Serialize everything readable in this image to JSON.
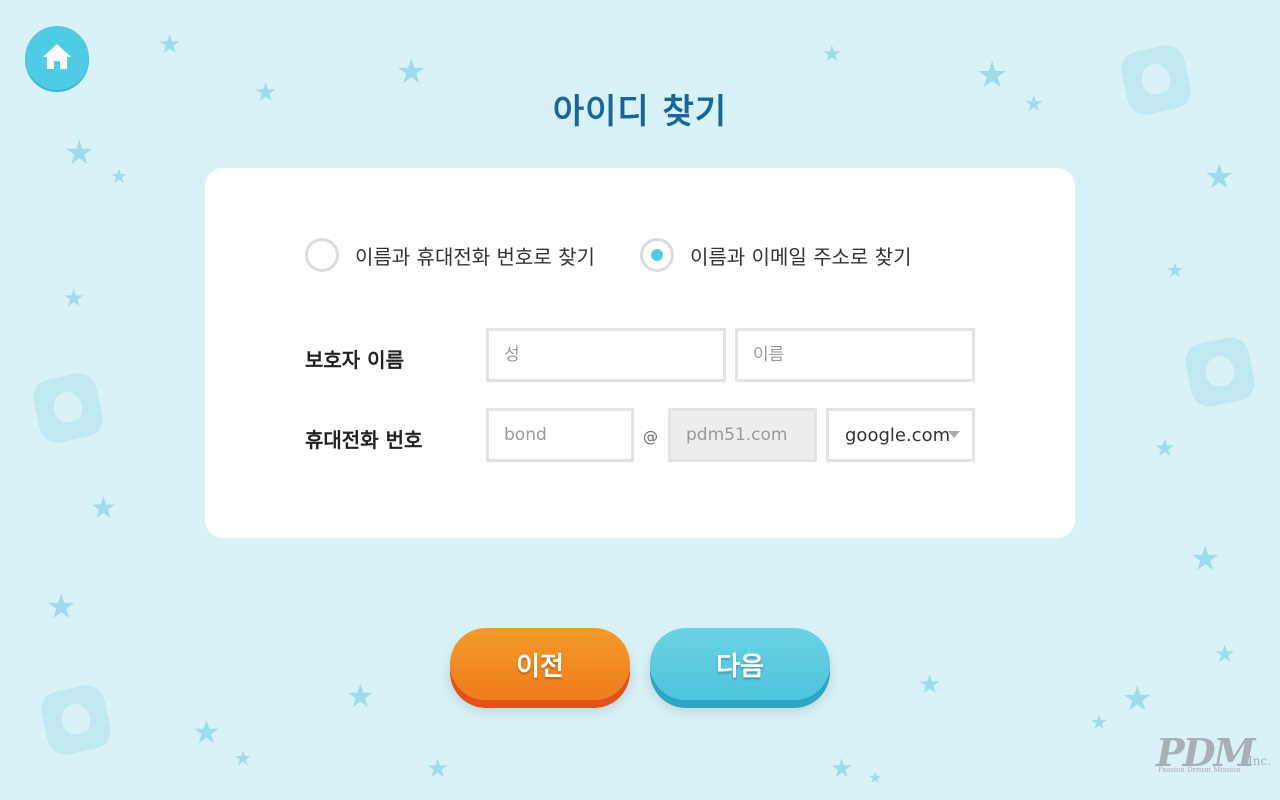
{
  "page": {
    "title": "아이디 찾기"
  },
  "search_options": [
    {
      "label": "이름과 휴대전화 번호로 찾기",
      "selected": false
    },
    {
      "label": "이름과 이메일 주소로 찾기",
      "selected": true
    }
  ],
  "form": {
    "guardian_name_label": "보호자 이름",
    "last_name_placeholder": "성",
    "first_name_placeholder": "이름",
    "phone_label": "휴대전화 번호",
    "email_id_placeholder": "bond",
    "at_symbol": "@",
    "email_domain_placeholder": "pdm51.com",
    "domain_select_value": "google.com"
  },
  "buttons": {
    "prev_label": "이전",
    "next_label": "다음"
  },
  "logo": {
    "mark": "PDM",
    "suffix": "Inc.",
    "tagline": "Passion Dream Mission"
  },
  "colors": {
    "background": "#d9f2f7",
    "title": "#17659a",
    "accent": "#4fcbe5",
    "prev_button": "#f08a22",
    "next_button": "#55c6de"
  },
  "icons": {
    "home": "home-icon",
    "dropdown": "chevron-down-icon"
  }
}
